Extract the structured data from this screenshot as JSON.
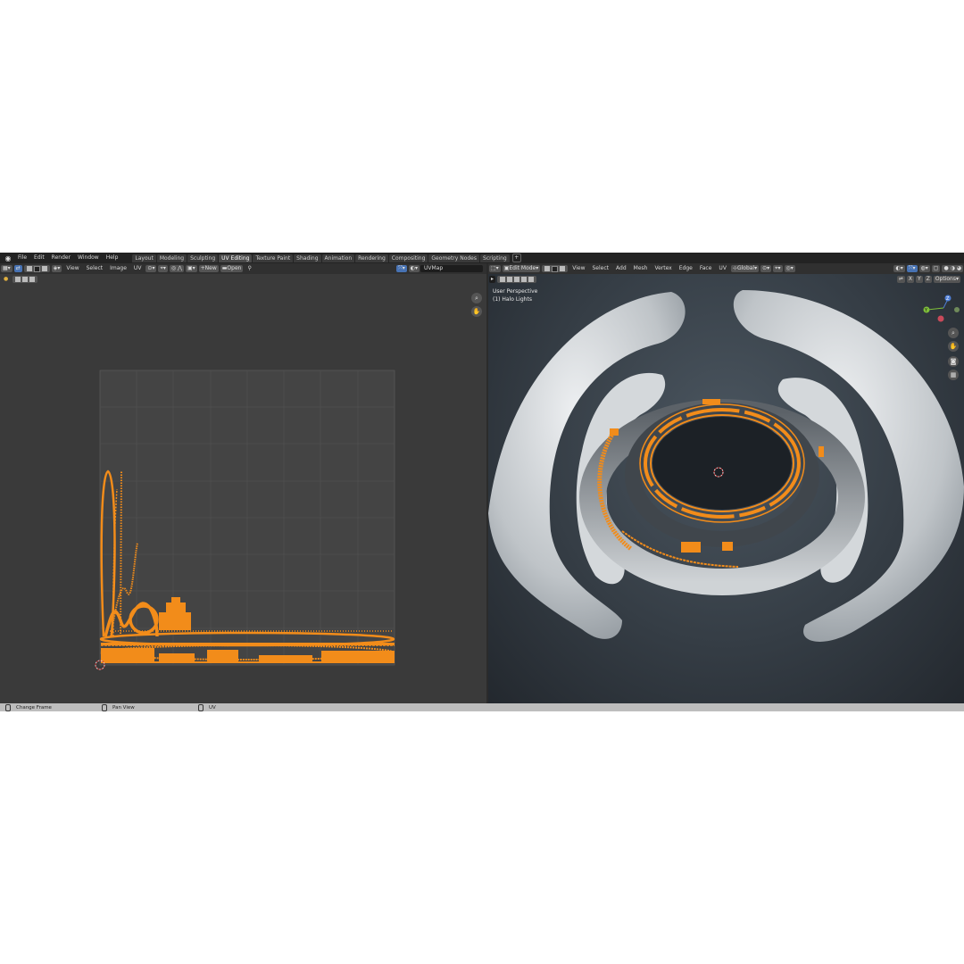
{
  "menu": [
    "File",
    "Edit",
    "Render",
    "Window",
    "Help"
  ],
  "workspaces": [
    {
      "label": "Layout",
      "active": false
    },
    {
      "label": "Modeling",
      "active": false
    },
    {
      "label": "Sculpting",
      "active": false
    },
    {
      "label": "UV Editing",
      "active": true
    },
    {
      "label": "Texture Paint",
      "active": false
    },
    {
      "label": "Shading",
      "active": false
    },
    {
      "label": "Animation",
      "active": false
    },
    {
      "label": "Rendering",
      "active": false
    },
    {
      "label": "Compositing",
      "active": false
    },
    {
      "label": "Geometry Nodes",
      "active": false
    },
    {
      "label": "Scripting",
      "active": false
    }
  ],
  "add_workspace": "+",
  "uv_editor": {
    "menus": [
      "View",
      "Select",
      "Image",
      "UV"
    ],
    "new_label": "New",
    "open_label": "Open",
    "uvmap_name": "UVMap"
  },
  "viewport": {
    "mode": "Edit Mode",
    "menus": [
      "View",
      "Select",
      "Add",
      "Mesh",
      "Vertex",
      "Edge",
      "Face",
      "UV"
    ],
    "transform_orientation": "Global",
    "options_label": "Options",
    "axes": [
      "X",
      "Y",
      "Z"
    ],
    "view_name": "User Perspective",
    "object_name": "(1) Halo Lights",
    "gizmo_labels": {
      "z": "Z",
      "y": "Y"
    }
  },
  "status_bar": {
    "items": [
      "Change Frame",
      "Pan View",
      "UV"
    ]
  },
  "colors": {
    "accent": "#4772b3",
    "uv_selected": "#f28c1a",
    "mesh_gray": "#d6d8da"
  }
}
